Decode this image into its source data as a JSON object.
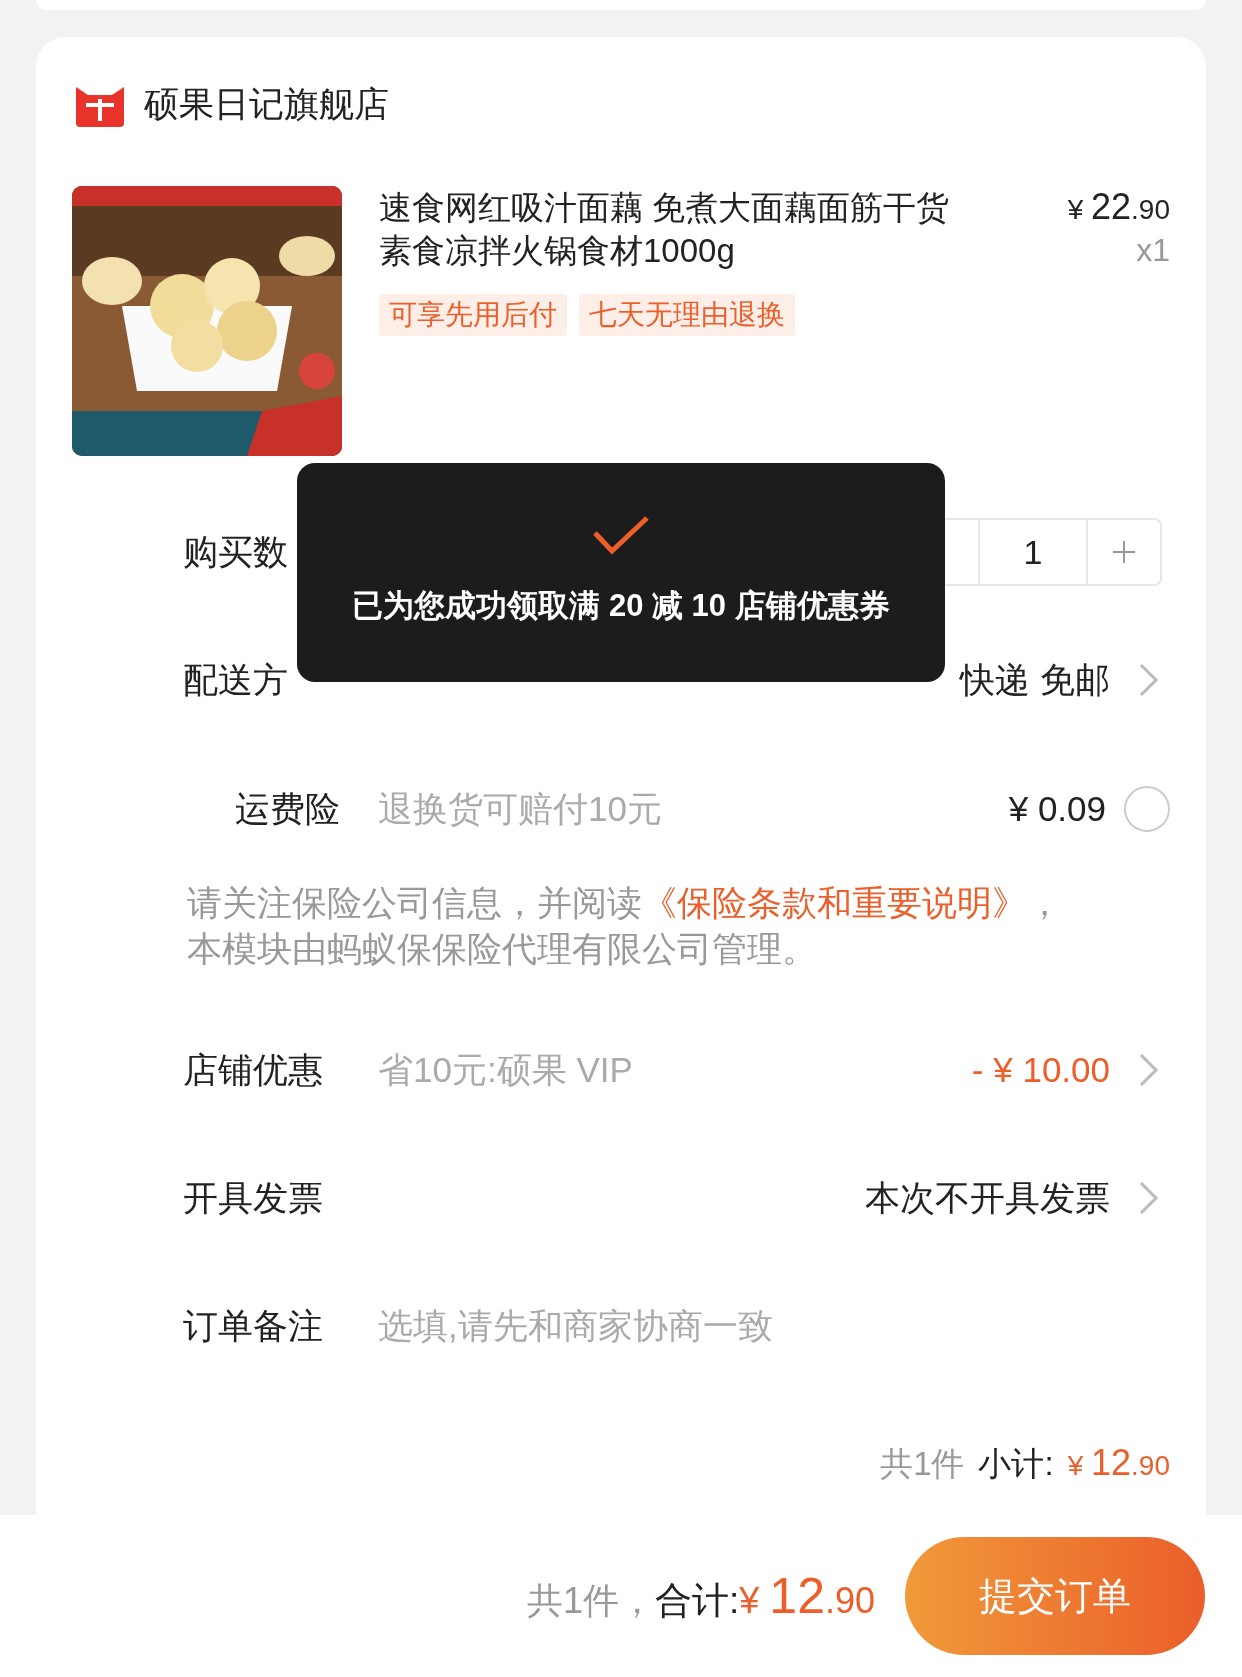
{
  "store": {
    "name": "硕果日记旗舰店"
  },
  "product": {
    "title": "速食网红吸汁面藕 免煮大面藕面筋干货素食凉拌火锅食材1000g",
    "currency": "¥",
    "integer": "22",
    "decimal": ".90",
    "quantity": "x1",
    "tags": [
      "可享先用后付",
      "七天无理由退换"
    ]
  },
  "rows": [
    {
      "kind": "stepper",
      "label": "购买数",
      "value": "1"
    },
    {
      "kind": "link",
      "label": "配送方",
      "value": "快递 免邮",
      "highlight": false
    },
    {
      "kind": "radio",
      "label": "运费险",
      "detail": "退换货可赔付10元",
      "value": "¥ 0.09",
      "selected": false
    },
    {
      "kind": "notice",
      "text": "请关注保险公司信息，并阅读",
      "link": "《保险条款和重要说明》",
      "after": "，本模块由蚂蚁保保险代理有限公司管理。"
    },
    {
      "kind": "link",
      "label": "店铺优惠",
      "detail": "省10元:硕果 VIP",
      "value": "- ¥ 10.00",
      "highlight": true
    },
    {
      "kind": "link",
      "label": "开具发票",
      "value": "本次不开具发票",
      "highlight": false
    },
    {
      "kind": "input",
      "label": "订单备注",
      "placeholder": "选填,请先和商家协商一致"
    }
  ],
  "subtotal": {
    "count": "共1件",
    "label": "小计:",
    "currency": "¥",
    "integer": "12",
    "decimal": ".90"
  },
  "toast": {
    "message": "已为您成功领取满 20 减 10 店铺优惠券"
  },
  "footer": {
    "count": "共1件，",
    "label": "合计:",
    "currency": "¥",
    "integer": "12",
    "decimal": ".90",
    "submit": "提交订单"
  }
}
